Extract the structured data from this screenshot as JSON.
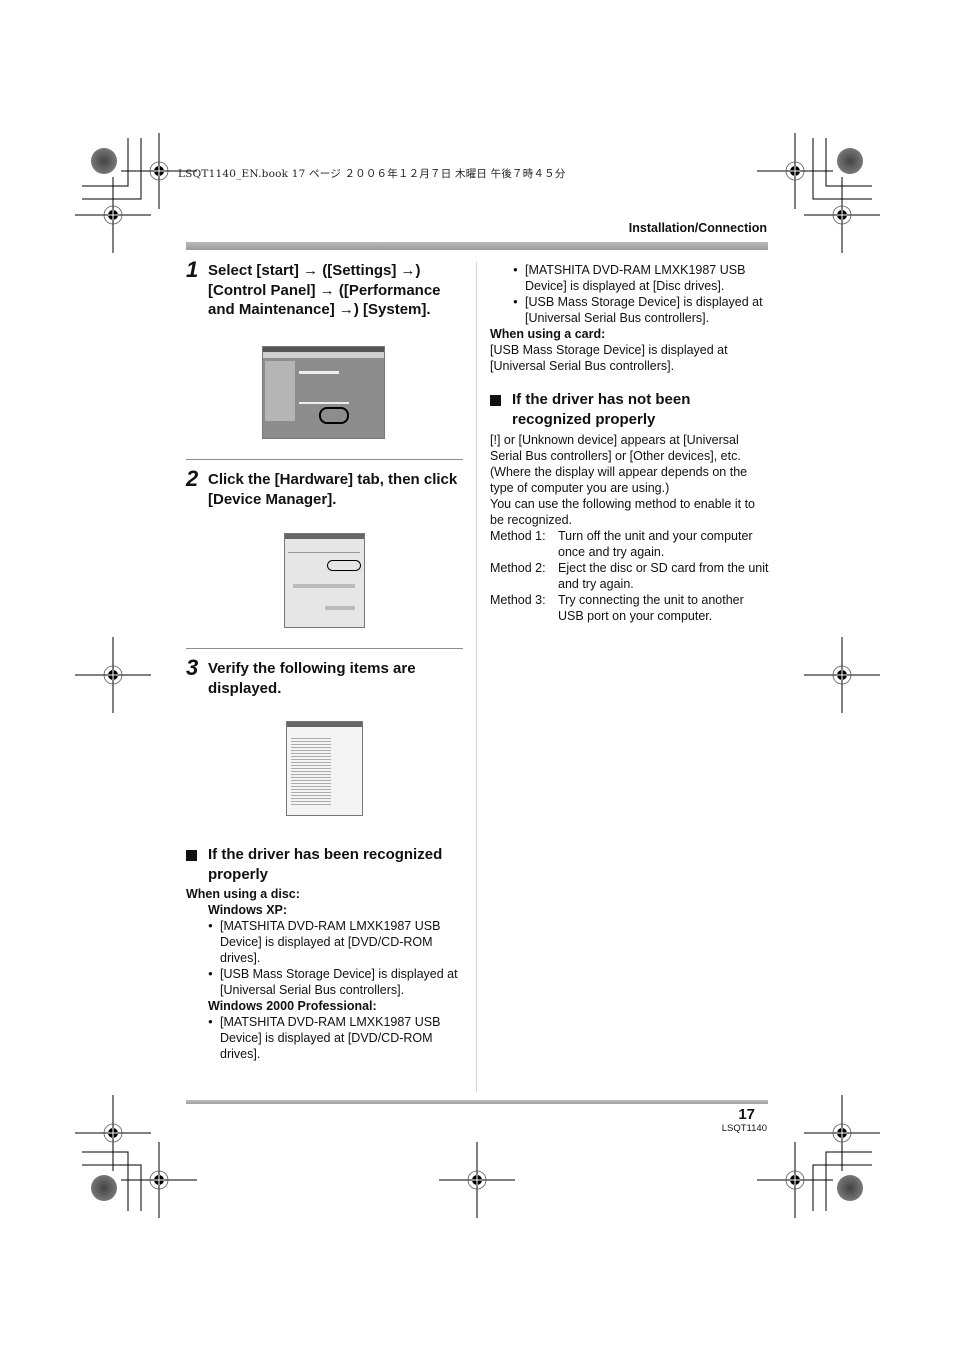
{
  "header": {
    "book_info": "LSQT1140_EN.book  17 ページ  ２００６年１２月７日  木曜日  午後７時４５分",
    "section_label": "Installation/Connection"
  },
  "steps": [
    {
      "number": "1",
      "text": "Select [start] → ([Settings] →) [Control Panel] → ([Performance and Maintenance] →) [System].",
      "image": "Performance and Maintenance window with System icon circled"
    },
    {
      "number": "2",
      "text": "Click the [Hardware] tab, then click [Device Manager].",
      "image": "System Properties dialog, Hardware tab, Device Manager button circled"
    },
    {
      "number": "3",
      "text": "Verify the following items are displayed.",
      "image": "Device Manager tree window"
    }
  ],
  "recognized": {
    "heading": "If the driver has been recognized properly",
    "disc_label": "When using a disc:",
    "xp_label": "Windows XP:",
    "xp_bullets": [
      "[MATSHITA DVD-RAM LMXK1987 USB Device] is displayed at [DVD/CD-ROM drives].",
      "[USB Mass Storage Device] is displayed at [Universal Serial Bus controllers]."
    ],
    "w2000_label": "Windows 2000 Professional:",
    "w2000_bullets": [
      "[MATSHITA DVD-RAM LMXK1987 USB Device] is displayed at [DVD/CD-ROM drives]."
    ]
  },
  "right": {
    "bullets": [
      "[MATSHITA DVD-RAM LMXK1987 USB Device] is displayed at [Disc drives].",
      "[USB Mass Storage Device] is displayed at [Universal Serial Bus controllers]."
    ],
    "card_label": "When using a card:",
    "card_text": "[USB Mass Storage Device] is displayed at [Universal Serial Bus controllers].",
    "not_recognized_heading": "If the driver has not been recognized properly",
    "para1": "[!] or [Unknown device] appears at [Universal Serial Bus controllers] or [Other devices], etc. (Where the display will appear depends on the type of computer you are using.)",
    "para2": "You can use the following method to enable it to be recognized.",
    "methods": [
      {
        "label": "Method 1:",
        "text": "Turn off the unit and your computer once and try again."
      },
      {
        "label": "Method 2:",
        "text": "Eject the disc or SD card from the unit and try again."
      },
      {
        "label": "Method 3:",
        "text": "Try connecting the unit to another USB port on your computer."
      }
    ]
  },
  "footer": {
    "page_number": "17",
    "page_code": "LSQT1140"
  }
}
